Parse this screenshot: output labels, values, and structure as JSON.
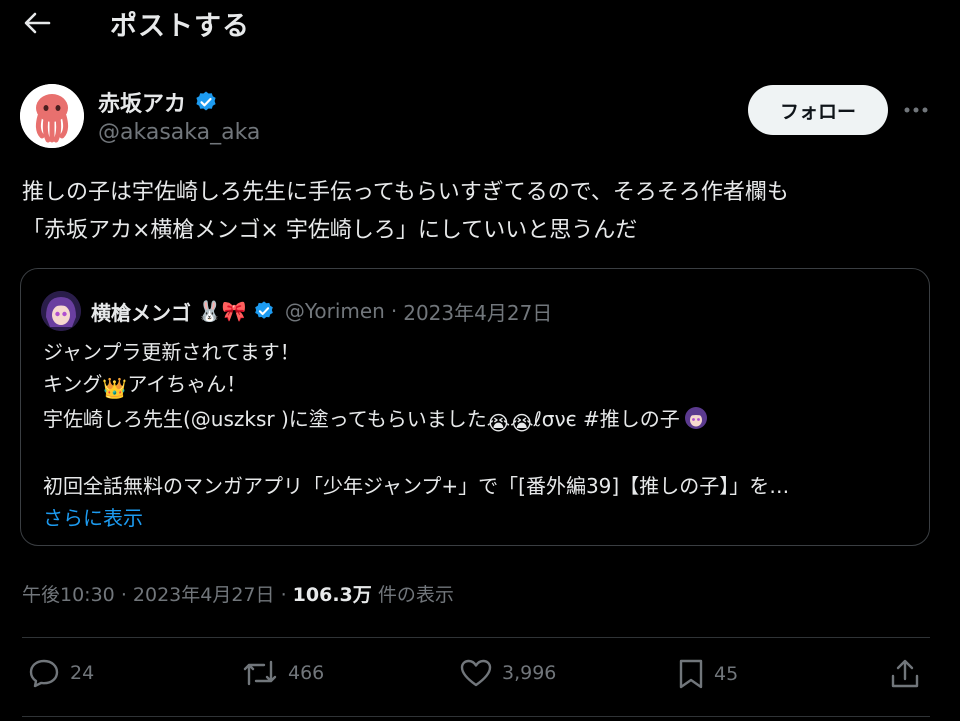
{
  "header": {
    "title": "ポストする",
    "back_icon": "arrow-left-icon"
  },
  "author": {
    "name": "赤坂アカ",
    "handle": "@akasaka_aka",
    "verified_color": "#1d9bf0",
    "follow_label": "フォロー"
  },
  "post": {
    "lines": [
      "推しの子は宇佐崎しろ先生に手伝ってもらいすぎてるので、そろそろ作者欄も",
      "「赤坂アカ×横槍メンゴ× 宇佐崎しろ」にしていいと思うんだ"
    ]
  },
  "quote": {
    "name": "横槍メンゴ",
    "name_emoji": "🐰🎀",
    "handle": "@Yorimen",
    "date": "2023年4月27日",
    "line1": "ジャンプラ更新されてます！",
    "line2_a": "キング",
    "line2_emoji": "👑",
    "line2_b": "アイちゃん！",
    "line3_a": "宇佐崎しろ先生(@uszksr )に塗ってもらいました",
    "line3_emoji": "😭😭",
    "line3_b": "ℓσνє  #推しの子",
    "line5": "初回全話無料のマンガアプリ「少年ジャンプ+」で「[番外編39]【推しの子】」を…",
    "show_more": "さらに表示"
  },
  "meta": {
    "time": "午後10:30",
    "date": "2023年4月27日",
    "views": "106.3万",
    "views_label": "件の表示"
  },
  "actions": {
    "replies": "24",
    "reposts": "466",
    "likes": "3,996",
    "bookmarks": "45"
  },
  "colors": {
    "background": "#000000",
    "text": "#e7e9ea",
    "muted": "#71767b",
    "accent": "#1d9bf0"
  }
}
